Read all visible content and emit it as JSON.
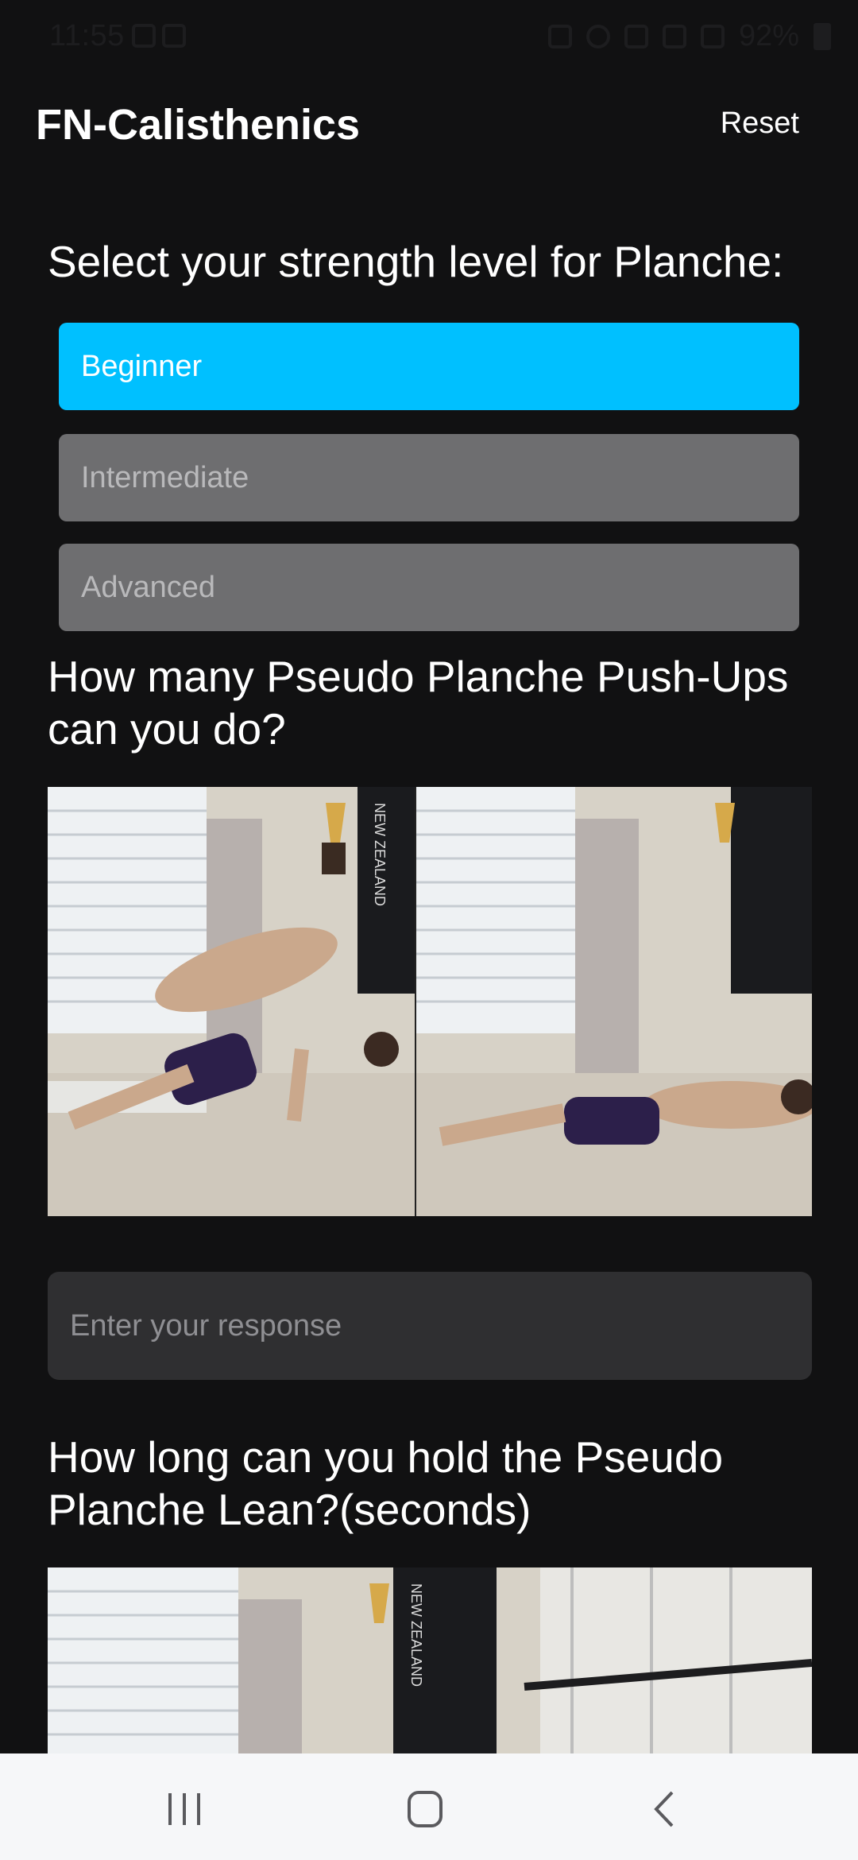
{
  "status_bar": {
    "time": "11:55",
    "battery": "92%",
    "icons": [
      "mail-icon",
      "teams-icon",
      "mute-icon",
      "hotspot-icon",
      "wifi-icon",
      "volte-icon",
      "signal-icon",
      "battery-icon"
    ]
  },
  "app_bar": {
    "title": "FN-Calisthenics",
    "reset_label": "Reset"
  },
  "strength": {
    "question": "Select your strength level for Planche:",
    "options": [
      {
        "label": "Beginner",
        "selected": true
      },
      {
        "label": "Intermediate",
        "selected": false
      },
      {
        "label": "Advanced",
        "selected": false
      }
    ],
    "colors": {
      "selected": "#00c0ff",
      "unselected": "#6e6e70"
    }
  },
  "q1": {
    "question": "How many Pseudo Planche Push-Ups can you do?",
    "image_flag_text": "NEW ZEALAND",
    "input_placeholder": "Enter your response"
  },
  "q2": {
    "question": "How long can you hold the Pseudo Planche Lean?(seconds)",
    "image_flag_text": "NEW ZEALAND"
  },
  "navbar": {
    "icons": [
      "recent-apps-icon",
      "home-icon",
      "back-icon"
    ]
  }
}
